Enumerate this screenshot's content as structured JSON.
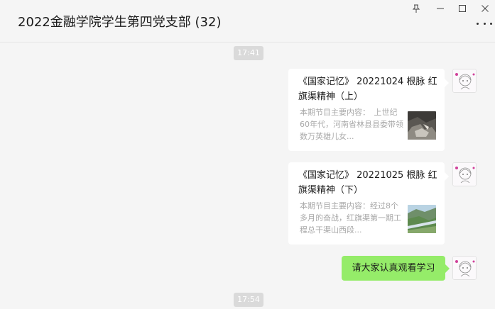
{
  "header": {
    "title": "2022金融学院学生第四党支部 (32)"
  },
  "window_controls": {
    "pin_icon": "pin-icon",
    "minimize_icon": "minimize-icon",
    "maximize_icon": "maximize-icon",
    "close_icon": "close-icon",
    "more_icon": "more-icon"
  },
  "messages": {
    "time1": "17:41",
    "card1": {
      "title": "《国家记忆》 20221024 根脉 红旗渠精神（上）",
      "desc": "本期节目主要内容：　上世纪60年代，河南省林县县委带领数万英雄儿女..."
    },
    "card2": {
      "title": "《国家记忆》 20221025 根脉 红旗渠精神（下）",
      "desc": "本期节目主要内容：经过8个多月的奋战，红旗渠第一期工程总干渠山西段..."
    },
    "text1": "请大家认真观看学习",
    "time2": "17:54"
  },
  "colors": {
    "background": "#f5f5f5",
    "own_bubble": "#95ec69",
    "card_bg": "#ffffff",
    "time_chip": "#dadada"
  }
}
